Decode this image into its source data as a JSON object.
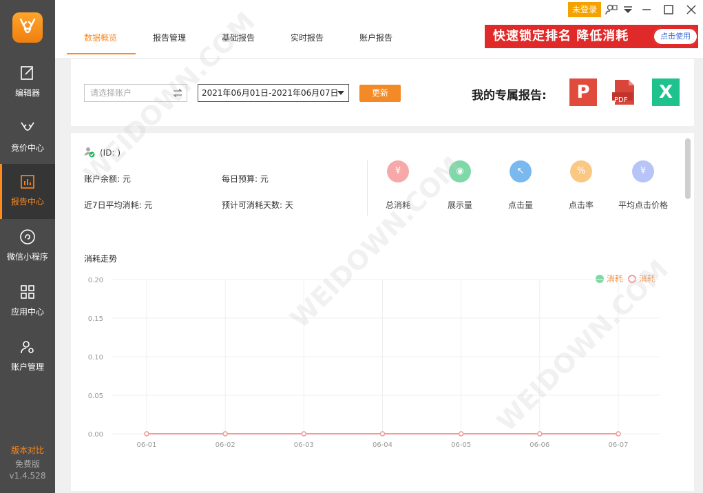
{
  "window": {
    "login_label": "未登录"
  },
  "sidebar": {
    "items": [
      {
        "label": "编辑器"
      },
      {
        "label": "竞价中心"
      },
      {
        "label": "报告中心"
      },
      {
        "label": "微信小程序"
      },
      {
        "label": "应用中心"
      },
      {
        "label": "账户管理"
      }
    ],
    "compare_label": "版本对比",
    "edition_label": "免费版",
    "version": "v1.4.528"
  },
  "tabs": [
    {
      "label": "数据概览",
      "active": true
    },
    {
      "label": "报告管理"
    },
    {
      "label": "基础报告"
    },
    {
      "label": "实时报告"
    },
    {
      "label": "账户报告"
    }
  ],
  "promo": {
    "text": "快速锁定排名 降低消耗",
    "button": "点击使用"
  },
  "filter": {
    "account_placeholder": "请选择账户",
    "date_range": "2021年06月01日-2021年06月07日",
    "update_label": "更新"
  },
  "reports": {
    "title": "我的专属报告:",
    "ppt": "P",
    "pdf": "PDF",
    "excel": "X"
  },
  "account": {
    "id_label": "(ID: )",
    "balance": "账户余额:  元",
    "daily_budget": "每日预算:  元",
    "avg7": "近7日平均消耗:  元",
    "days_left": "预计可消耗天数:  天"
  },
  "metrics": [
    {
      "label": "总消耗",
      "symbol": "¥",
      "color": "#f7a9a9"
    },
    {
      "label": "展示量",
      "symbol": "◉",
      "color": "#7fd8a8"
    },
    {
      "label": "点击量",
      "symbol": "↖",
      "color": "#79b9ef"
    },
    {
      "label": "点击率",
      "symbol": "%",
      "color": "#fbc884"
    },
    {
      "label": "平均点击价格",
      "symbol": "¥",
      "color": "#b7c4f7"
    }
  ],
  "chart_data": {
    "type": "line",
    "title": "消耗走势",
    "categories": [
      "06-01",
      "06-02",
      "06-03",
      "06-04",
      "06-05",
      "06-06",
      "06-07"
    ],
    "series": [
      {
        "name": "消耗",
        "color": "#7fd8a8",
        "values": [
          0,
          0,
          0,
          0,
          0,
          0,
          0
        ]
      },
      {
        "name": "消耗",
        "color": "#f39a9a",
        "values": [
          0,
          0,
          0,
          0,
          0,
          0,
          0
        ]
      }
    ],
    "ylim": [
      0,
      0.2
    ],
    "yticks": [
      "0.20",
      "0.15",
      "0.10",
      "0.05",
      "0.00"
    ],
    "grid": true,
    "legend": "top-right"
  }
}
